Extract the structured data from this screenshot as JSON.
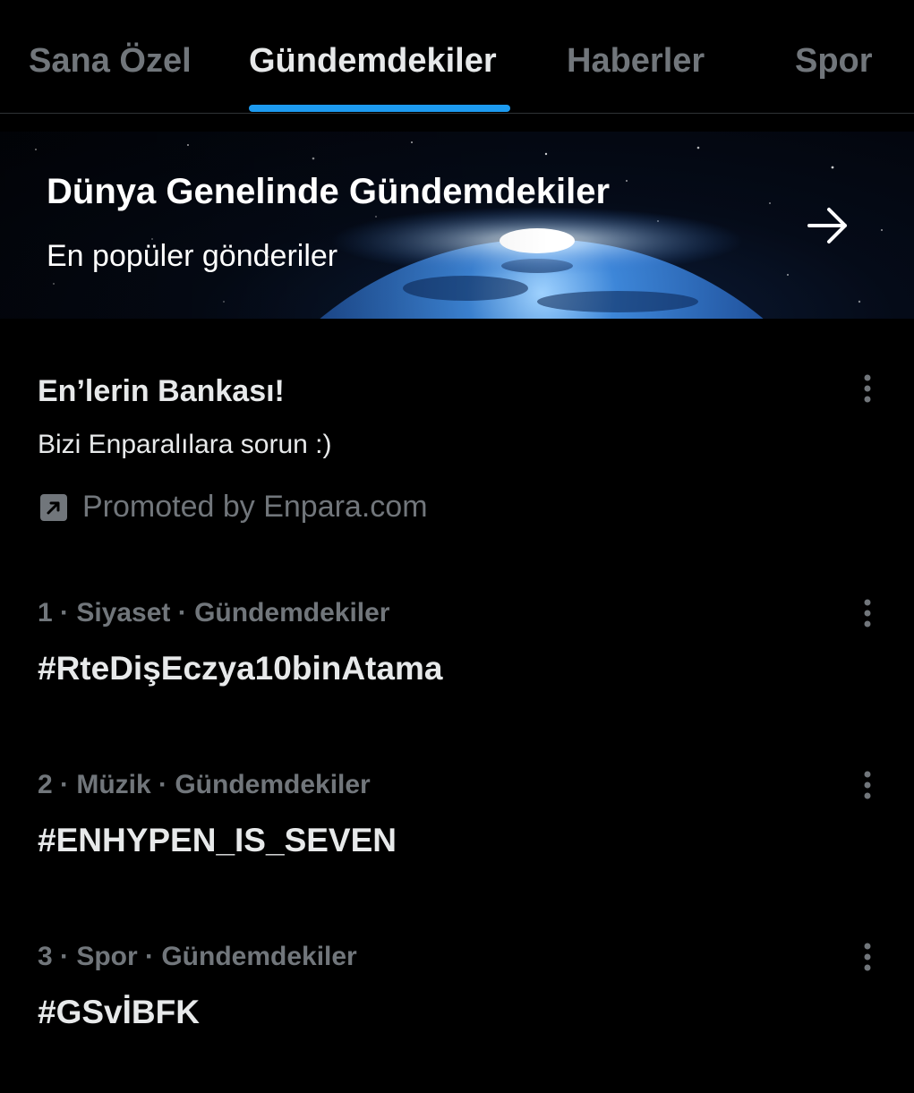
{
  "tabs": [
    {
      "label": "Sana Özel",
      "active": false
    },
    {
      "label": "Gündemdekiler",
      "active": true
    },
    {
      "label": "Haberler",
      "active": false
    },
    {
      "label": "Spor",
      "active": false
    }
  ],
  "hero": {
    "title": "Dünya Genelinde Gündemdekiler",
    "subtitle": "En popüler gönderiler",
    "arrow_icon": "arrow-right-icon"
  },
  "promoted": {
    "title": "En’lerin Bankası!",
    "description": "Bizi Enparalılara sorun :)",
    "promoted_by": "Promoted by Enpara.com",
    "promoted_icon": "promoted-arrow-icon"
  },
  "trends": [
    {
      "meta": "1 · Siyaset · Gündemdekiler",
      "hashtag": "#RteDişEczya10binAtama"
    },
    {
      "meta": "2 · Müzik · Gündemdekiler",
      "hashtag": "#ENHYPEN_IS_SEVEN"
    },
    {
      "meta": "3 · Spor · Gündemdekiler",
      "hashtag": "#GSvİBFK"
    }
  ],
  "colors": {
    "background": "#000000",
    "primary_text": "#e7e9ea",
    "secondary_text": "#71767b",
    "accent": "#1d9bf0",
    "divider": "#2f3336"
  }
}
